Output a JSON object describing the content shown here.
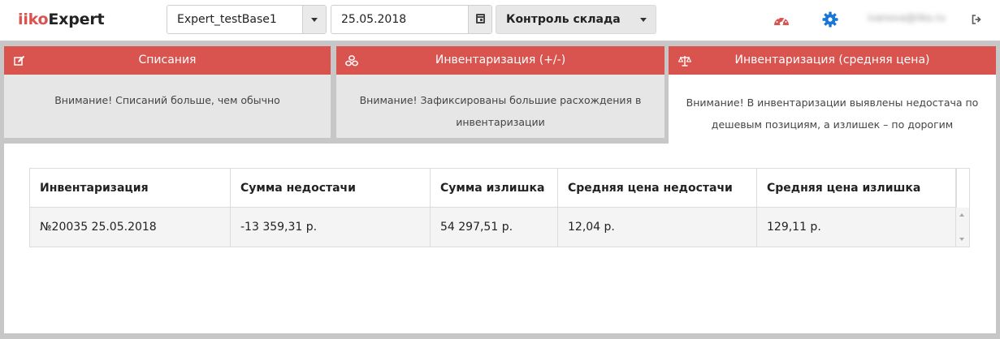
{
  "header": {
    "logo_part1": "iiko",
    "logo_part2": "Expert",
    "database_select": {
      "value": "Expert_testBase1"
    },
    "date_field": {
      "value": "25.05.2018"
    },
    "mode_select": {
      "value": "Контроль склада"
    },
    "user_email": "ivanova@iiko.ru",
    "icons": [
      "dashboard-gauge-icon",
      "settings-gear-icon",
      "logout-icon"
    ]
  },
  "cards": [
    {
      "title": "Списания",
      "icon": "edit-icon",
      "message": "Внимание! Списаний больше, чем обычно"
    },
    {
      "title": "Инвентаризация (+/-)",
      "icon": "coins-icon",
      "message": "Внимание! Зафиксированы большие расхождения в инвентаризации"
    },
    {
      "title": "Инвентаризация (средняя цена)",
      "icon": "balance-scale-icon",
      "message": "Внимание! В инвентаризации выявлены недостача по дешевым позициям, а излишек – по дорогим"
    }
  ],
  "table": {
    "columns": [
      "Инвентаризация",
      "Сумма недостачи",
      "Сумма излишка",
      "Средняя цена недостачи",
      "Средняя цена излишка"
    ],
    "rows": [
      [
        "№20035 25.05.2018",
        "-13 359,31 р.",
        "54 297,51 р.",
        "12,04 р.",
        "129,11 р."
      ]
    ]
  },
  "colors": {
    "accent": "#d9534f",
    "frame": "#c7c7c7",
    "gear": "#1976d2"
  }
}
